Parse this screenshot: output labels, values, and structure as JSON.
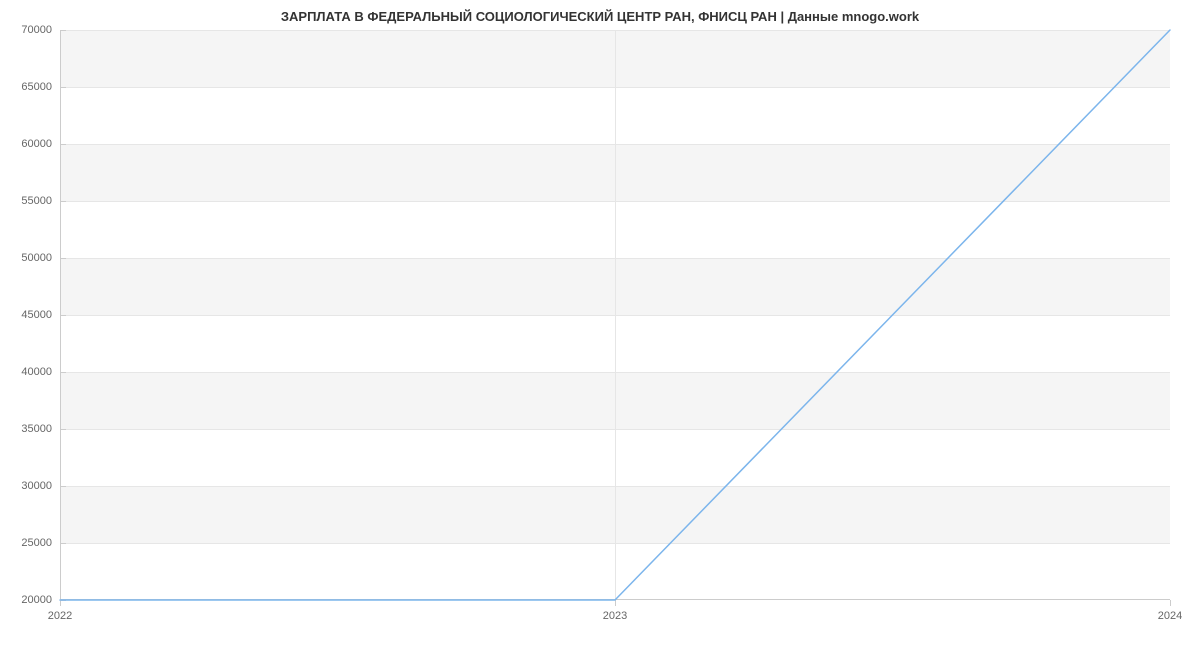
{
  "chart_data": {
    "type": "line",
    "title": "ЗАРПЛАТА В ФЕДЕРАЛЬНЫЙ СОЦИОЛОГИЧЕСКИЙ ЦЕНТР РАН, ФНИСЦ РАН | Данные mnogo.work",
    "x": [
      2022,
      2023,
      2024
    ],
    "values": [
      20000,
      20000,
      70000
    ],
    "xlabel": "",
    "ylabel": "",
    "xlim": [
      2022,
      2024
    ],
    "ylim": [
      20000,
      70000
    ],
    "x_ticks": [
      2022,
      2023,
      2024
    ],
    "y_ticks": [
      20000,
      25000,
      30000,
      35000,
      40000,
      45000,
      50000,
      55000,
      60000,
      65000,
      70000
    ]
  }
}
